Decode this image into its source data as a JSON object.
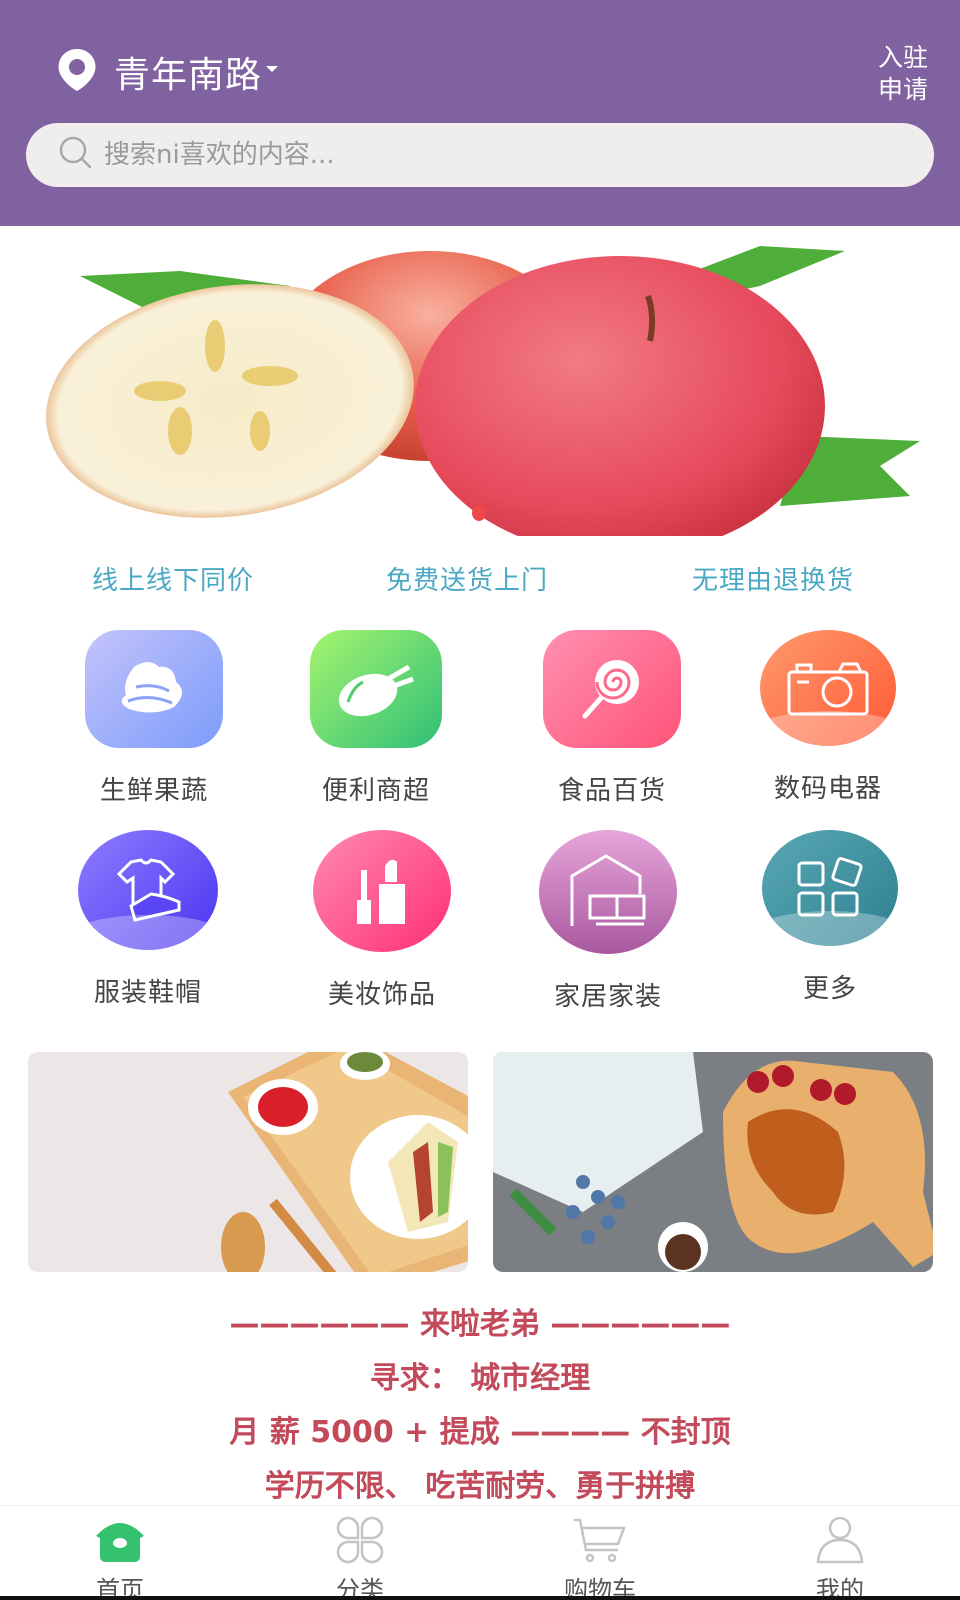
{
  "header": {
    "location": "青年南路",
    "location_icon": "map-pin-icon",
    "apply_line1": "入驻",
    "apply_line2": "申请",
    "search_placeholder": "搜索ni喜欢的内容...",
    "background_color": "#8062a1"
  },
  "banner": {
    "description": "apples with leaves",
    "active_slide": 1,
    "slide_count": 1,
    "indicator_color": "#f04848"
  },
  "promises": [
    "线上线下同价",
    "免费送货上门",
    "无理由退换货"
  ],
  "categories": [
    {
      "label": "生鲜果蔬",
      "icon": "vegetables-icon"
    },
    {
      "label": "便利商超",
      "icon": "roast-chicken-icon"
    },
    {
      "label": "食品百货",
      "icon": "lollipop-icon"
    },
    {
      "label": "数码电器",
      "icon": "camera-icon"
    },
    {
      "label": "服装鞋帽",
      "icon": "clothes-shoes-icon"
    },
    {
      "label": "美妆饰品",
      "icon": "cosmetics-icon"
    },
    {
      "label": "家居家装",
      "icon": "home-furniture-icon"
    },
    {
      "label": "更多",
      "icon": "more-grid-icon"
    }
  ],
  "promo_cards": [
    {
      "description": "sandwich breakfast tray"
    },
    {
      "description": "croissant on cutting board"
    }
  ],
  "recruit": {
    "line1": "—————— 来啦老弟 ——————",
    "line2": "寻求： 城市经理",
    "line3": "月 薪 5000 + 提成 ———— 不封顶",
    "line4": "学历不限、 吃苦耐劳、勇于拼搏",
    "color": "#c24a5a"
  },
  "tabbar": {
    "active_color": "#35c26f",
    "items": [
      {
        "label": "首页",
        "icon": "home-icon",
        "active": true
      },
      {
        "label": "分类",
        "icon": "category-icon",
        "active": false
      },
      {
        "label": "购物车",
        "icon": "cart-icon",
        "active": false
      },
      {
        "label": "我的",
        "icon": "user-icon",
        "active": false
      }
    ]
  }
}
